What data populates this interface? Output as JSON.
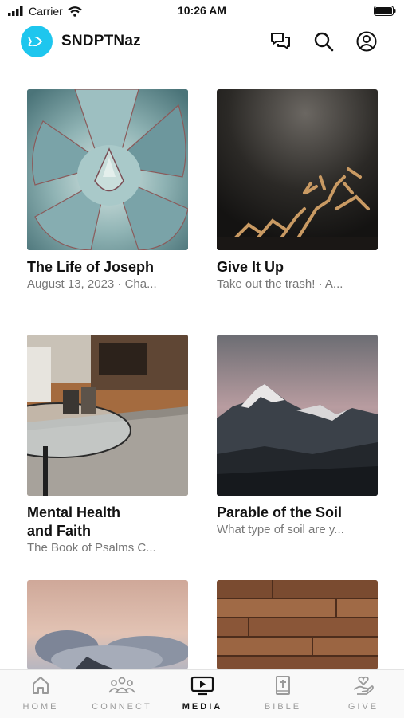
{
  "status_bar": {
    "carrier": "Carrier",
    "time": "10:26 AM"
  },
  "header": {
    "title": "SNDPTNaz"
  },
  "media_items": [
    {
      "title": "The Life of Joseph",
      "subtitle": "August 13, 2023 · Cha..."
    },
    {
      "title": "Give It Up",
      "subtitle": "Take out the trash! · A..."
    },
    {
      "title_line1": "Mental Health",
      "title_line2": "and Faith",
      "subtitle": "The Book of Psalms C..."
    },
    {
      "title": "Parable of the Soil",
      "subtitle": "What type of soil are y..."
    }
  ],
  "tabs": [
    {
      "label": "HOME",
      "icon": "home-icon"
    },
    {
      "label": "CONNECT",
      "icon": "people-icon"
    },
    {
      "label": "MEDIA",
      "icon": "tv-play-icon"
    },
    {
      "label": "BIBLE",
      "icon": "bible-icon"
    },
    {
      "label": "GIVE",
      "icon": "hand-heart-icon"
    }
  ],
  "colors": {
    "brand": "#1ec6ee",
    "active_tab": "#111111",
    "inactive_tab": "#9a9a9a"
  }
}
